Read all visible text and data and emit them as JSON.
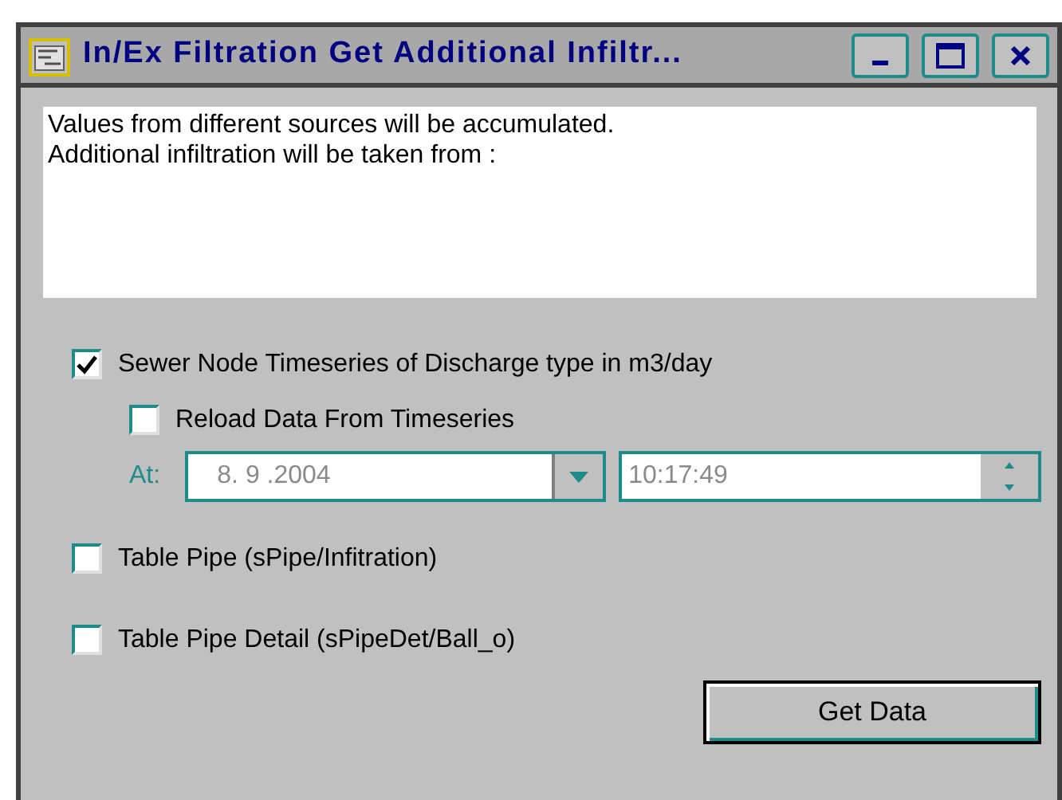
{
  "window": {
    "title": "In/Ex Filtration Get Additional Infiltr..."
  },
  "message": [
    "Values from different sources will be accumulated.",
    "Additional infiltration will be taken from :"
  ],
  "options": [
    {
      "kind": "checkbox",
      "label": "Sewer Node Timeseries of Discharge type in m3/day",
      "checked": true,
      "children": [
        {
          "kind": "checkbox",
          "label": "Reload Data From Timeseries",
          "checked": false
        },
        {
          "kind": "datetime",
          "label": "At:",
          "date": "8. 9 .2004",
          "time": "10:17:49",
          "disabled": true
        }
      ]
    },
    {
      "kind": "checkbox",
      "label": "Table Pipe (sPipe/Infitration)",
      "checked": false
    },
    {
      "kind": "checkbox",
      "label": "Table Pipe Detail (sPipeDet/Ball_o)",
      "checked": false
    }
  ],
  "button": "Get Data"
}
